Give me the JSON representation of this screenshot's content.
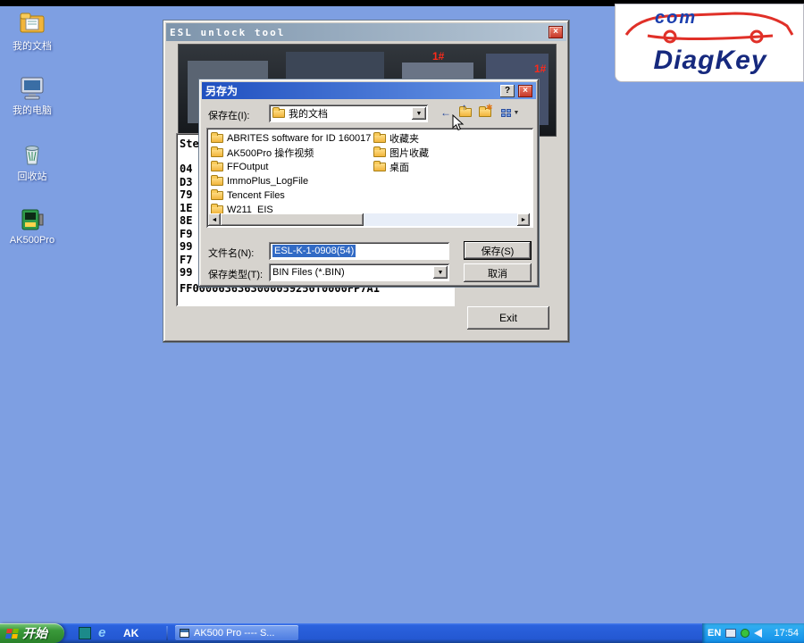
{
  "desktop": {
    "icons": [
      {
        "label": "我的文档"
      },
      {
        "label": "我的电脑"
      },
      {
        "label": "回收站"
      },
      {
        "label": "AK500Pro"
      }
    ]
  },
  "logo": {
    "top": "com",
    "brand": "DiagKey"
  },
  "esl_window": {
    "title": "ESL unlock tool",
    "close_label": "×",
    "photo_labels": [
      "1#",
      "1#"
    ],
    "list_header": "Ste",
    "hex_rows": [
      "04",
      "D3",
      "79",
      "1E",
      "8E",
      "F9",
      "99",
      "F7",
      "99"
    ],
    "hex_line": "FF0000636363000059250T0000FP7A1",
    "exit_label": "Exit"
  },
  "save_dialog": {
    "title": "另存为",
    "help_label": "?",
    "close_label": "×",
    "save_in": {
      "label": "保存在(I):",
      "value": "我的文档"
    },
    "folders_col1": [
      "ABRITES software for ID 160017",
      "AK500Pro 操作视频",
      "FFOutput",
      "ImmoPlus_LogFile",
      "Tencent Files",
      "W211_EIS"
    ],
    "folders_col2": [
      "收藏夹",
      "图片收藏",
      "桌面"
    ],
    "filename": {
      "label": "文件名(N):",
      "value": "ESL-K-1-0908(54)"
    },
    "filetype": {
      "label": "保存类型(T):",
      "value": "BIN Files (*.BIN)"
    },
    "buttons": {
      "save": "保存(S)",
      "cancel": "取消"
    }
  },
  "taskbar": {
    "start_label": "开始",
    "quick_launch_label": "AK",
    "ie_label": "e",
    "task_button_label": "AK500 Pro ---- S...",
    "tray": {
      "lang": "EN",
      "time": "17:54"
    }
  },
  "icon_glyphs": {
    "back": "←",
    "up_folder": "↑",
    "new_folder": "✱",
    "dropdown": "▼",
    "scroll_left": "◄",
    "scroll_right": "►"
  },
  "colors": {
    "desktop": "#7e9fe2",
    "selection": "#316ac5",
    "dialog_title_left": "#2050c0"
  }
}
